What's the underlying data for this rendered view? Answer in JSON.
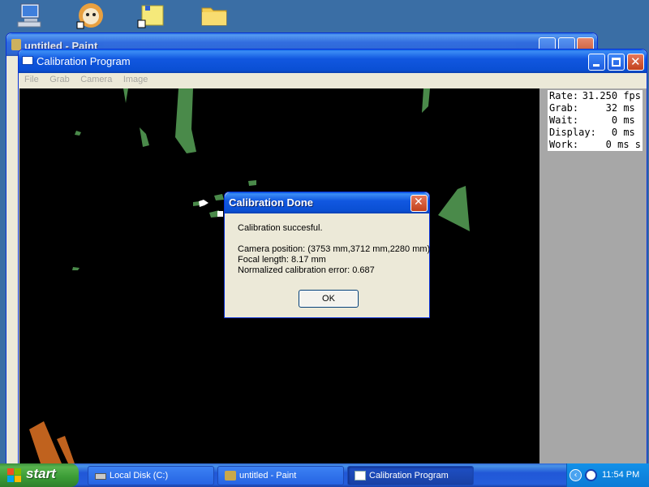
{
  "paint_window": {
    "title": "untitled - Paint"
  },
  "calibration_window": {
    "title": "Calibration Program",
    "menu": [
      "File",
      "Grab",
      "Camera",
      "Image"
    ]
  },
  "stats": [
    {
      "label": "Rate:",
      "value": "31.250 fps"
    },
    {
      "label": "Grab:",
      "value": "32 ms "
    },
    {
      "label": "Wait:",
      "value": "0 ms "
    },
    {
      "label": "Display:",
      "value": "0 ms "
    },
    {
      "label": "Work:",
      "value": "0 ms s"
    }
  ],
  "dialog": {
    "title": "Calibration Done",
    "lines": [
      "Calibration succesful.",
      "Camera position: (3753 mm,3712 mm,2280 mm)",
      "Focal length: 8.17 mm",
      "Normalized calibration error: 0.687"
    ],
    "ok_label": "OK"
  },
  "taskbar": {
    "start_label": "start",
    "buttons": [
      "Local Disk (C:)",
      "untitled - Paint",
      "Calibration Program"
    ],
    "active_index": 2,
    "clock": "11:54 PM"
  },
  "icons": {
    "desktop": [
      "my-computer-icon",
      "mascot-shortcut-icon",
      "folder-shortcut-icon",
      "folder-icon"
    ]
  },
  "colors": {
    "desktop": "#3a6ea5",
    "camera_background": "#000000",
    "blob_green": "#4a8a4a",
    "blob_orange": "#c0621e"
  }
}
